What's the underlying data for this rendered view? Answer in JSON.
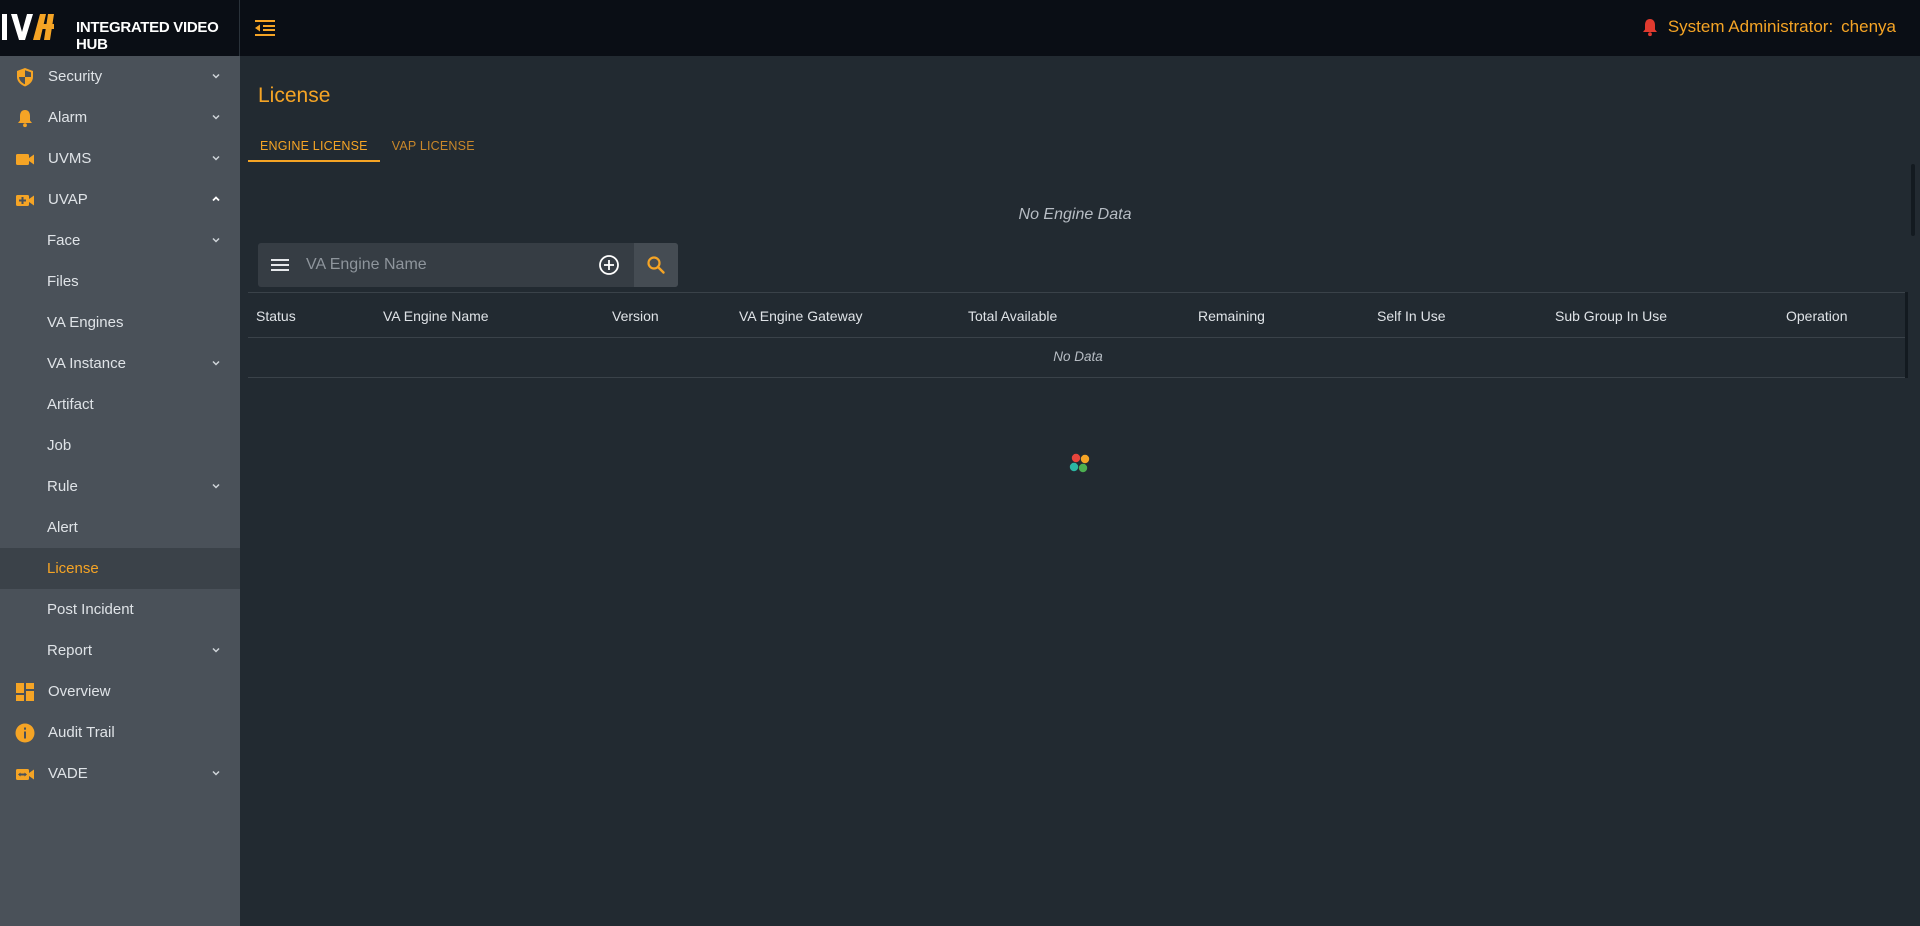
{
  "app": {
    "logo_text": "IVH",
    "title": "INTEGRATED VIDEO HUB"
  },
  "header": {
    "role_label": "System Administrator:",
    "user_name": "chenya"
  },
  "sidebar": {
    "items": [
      {
        "label": "Security",
        "icon": "shield-icon",
        "expandable": true
      },
      {
        "label": "Alarm",
        "icon": "bell-icon",
        "expandable": true
      },
      {
        "label": "UVMS",
        "icon": "video-camera-icon",
        "expandable": true
      },
      {
        "label": "UVAP",
        "icon": "video-plus-icon",
        "expandable": true,
        "expanded": true
      },
      {
        "label": "Face",
        "sub": true,
        "expandable": true
      },
      {
        "label": "Files",
        "sub": true
      },
      {
        "label": "VA Engines",
        "sub": true
      },
      {
        "label": "VA Instance",
        "sub": true,
        "expandable": true
      },
      {
        "label": "Artifact",
        "sub": true
      },
      {
        "label": "Job",
        "sub": true
      },
      {
        "label": "Rule",
        "sub": true,
        "expandable": true
      },
      {
        "label": "Alert",
        "sub": true
      },
      {
        "label": "License",
        "sub": true,
        "active": true
      },
      {
        "label": "Post Incident",
        "sub": true
      },
      {
        "label": "Report",
        "sub": true,
        "expandable": true
      },
      {
        "label": "Overview",
        "icon": "dashboard-icon"
      },
      {
        "label": "Audit Trail",
        "icon": "info-icon"
      },
      {
        "label": "VADE",
        "icon": "video-settings-icon",
        "expandable": true
      }
    ]
  },
  "main": {
    "title": "License",
    "tabs": [
      {
        "label": "ENGINE LICENSE",
        "active": true
      },
      {
        "label": "VAP LICENSE",
        "active": false
      }
    ],
    "empty_engine_text": "No Engine Data",
    "search": {
      "placeholder": "VA Engine Name",
      "value": ""
    },
    "table": {
      "columns": [
        "Status",
        "VA Engine Name",
        "Version",
        "VA Engine Gateway",
        "Total Available",
        "Remaining",
        "Self In Use",
        "Sub Group In Use",
        "Operation"
      ],
      "empty_text": "No Data"
    }
  },
  "colors": {
    "accent": "#f5a425",
    "topbar": "#0a0e15",
    "sidebar": "#4a5159",
    "content": "#222a31",
    "bell": "#e03a2f"
  }
}
